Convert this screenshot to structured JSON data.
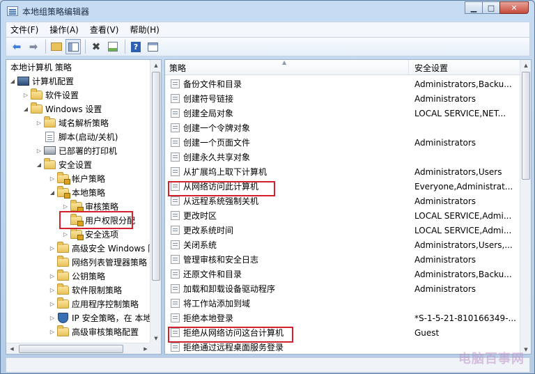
{
  "window": {
    "title": "本地组策略编辑器",
    "min": "▁",
    "max": "□",
    "close": "✕"
  },
  "menu": [
    "文件(F)",
    "操作(A)",
    "查看(V)",
    "帮助(H)"
  ],
  "tree": {
    "nodes": [
      {
        "label": "本地计算机 策略",
        "icon": "none",
        "toggle": ""
      },
      {
        "label": "计算机配置",
        "icon": "computer-icon",
        "toggle": "◢"
      },
      {
        "label": "软件设置",
        "icon": "folder-icon",
        "toggle": "▷"
      },
      {
        "label": "Windows 设置",
        "icon": "folder-icon",
        "toggle": "◢"
      },
      {
        "label": "域名解析策略",
        "icon": "folder-icon",
        "toggle": "▷"
      },
      {
        "label": "脚本(启动/关机)",
        "icon": "script-icon",
        "toggle": ""
      },
      {
        "label": "已部署的打印机",
        "icon": "printer-icon",
        "toggle": "▷"
      },
      {
        "label": "安全设置",
        "icon": "folder-icon",
        "toggle": "◢"
      },
      {
        "label": "帐户策略",
        "icon": "folder-lock-icon",
        "toggle": "▷"
      },
      {
        "label": "本地策略",
        "icon": "folder-lock-icon",
        "toggle": "◢"
      },
      {
        "label": "审核策略",
        "icon": "folder-lock-icon",
        "toggle": "▷"
      },
      {
        "label": "用户权限分配",
        "icon": "folder-lock-icon",
        "toggle": ""
      },
      {
        "label": "安全选项",
        "icon": "folder-lock-icon",
        "toggle": "▷"
      },
      {
        "label": "高级安全 Windows 防",
        "icon": "folder-icon",
        "toggle": "▷"
      },
      {
        "label": "网络列表管理器策略",
        "icon": "folder-icon",
        "toggle": ""
      },
      {
        "label": "公钥策略",
        "icon": "folder-icon",
        "toggle": "▷"
      },
      {
        "label": "软件限制策略",
        "icon": "folder-icon",
        "toggle": "▷"
      },
      {
        "label": "应用程序控制策略",
        "icon": "folder-icon",
        "toggle": "▷"
      },
      {
        "label": "IP 安全策略，在 本地计",
        "icon": "shield-icon",
        "toggle": "▷"
      },
      {
        "label": "高级审核策略配置",
        "icon": "folder-icon",
        "toggle": "▷"
      }
    ]
  },
  "list": {
    "headers": {
      "policy": "策略",
      "setting": "安全设置"
    },
    "rows": [
      {
        "policy": "备份文件和目录",
        "setting": "Administrators,Backu..."
      },
      {
        "policy": "创建符号链接",
        "setting": "Administrators"
      },
      {
        "policy": "创建全局对象",
        "setting": "LOCAL SERVICE,NET..."
      },
      {
        "policy": "创建一个令牌对象",
        "setting": ""
      },
      {
        "policy": "创建一个页面文件",
        "setting": "Administrators"
      },
      {
        "policy": "创建永久共享对象",
        "setting": ""
      },
      {
        "policy": "从扩展坞上取下计算机",
        "setting": "Administrators,Users"
      },
      {
        "policy": "从网络访问此计算机",
        "setting": "Everyone,Administrat..."
      },
      {
        "policy": "从远程系统强制关机",
        "setting": "Administrators"
      },
      {
        "policy": "更改时区",
        "setting": "LOCAL SERVICE,Admi..."
      },
      {
        "policy": "更改系统时间",
        "setting": "LOCAL SERVICE,Admi..."
      },
      {
        "policy": "关闭系统",
        "setting": "Administrators,Users,..."
      },
      {
        "policy": "管理审核和安全日志",
        "setting": "Administrators"
      },
      {
        "policy": "还原文件和目录",
        "setting": "Administrators,Backu..."
      },
      {
        "policy": "加载和卸载设备驱动程序",
        "setting": "Administrators"
      },
      {
        "policy": "将工作站添加到域",
        "setting": ""
      },
      {
        "policy": "拒绝本地登录",
        "setting": "*S-1-5-21-810166349-..."
      },
      {
        "policy": "拒绝从网络访问这台计算机",
        "setting": "Guest"
      },
      {
        "policy": "拒绝通过远程桌面服务登录",
        "setting": ""
      }
    ]
  },
  "watermark": "电脑百事网",
  "colors": {
    "highlight": "#d2202c"
  }
}
